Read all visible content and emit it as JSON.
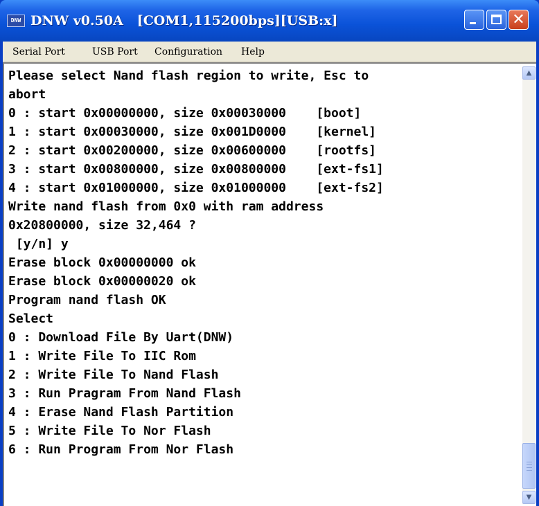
{
  "window": {
    "icon_text": "DNW",
    "title": "DNW v0.50A   [COM1,115200bps][USB:x]"
  },
  "menu": [
    "Serial Port",
    "USB Port",
    "Configuration",
    "Help"
  ],
  "console": {
    "lines": [
      "Please select Nand flash region to write, Esc to",
      "abort",
      "0 : start 0x00000000, size 0x00030000    [boot]",
      "1 : start 0x00030000, size 0x001D0000    [kernel]",
      "2 : start 0x00200000, size 0x00600000    [rootfs]",
      "3 : start 0x00800000, size 0x00800000    [ext-fs1]",
      "4 : start 0x01000000, size 0x01000000    [ext-fs2]",
      "Write nand flash from 0x0 with ram address",
      "0x20800000, size 32,464 ?",
      " [y/n] y",
      "Erase block 0x00000000 ok",
      "Erase block 0x00000020 ok",
      "Program nand flash OK",
      "Select",
      "0 : Download File By Uart(DNW)",
      "1 : Write File To IIC Rom",
      "2 : Write File To Nand Flash",
      "3 : Run Pragram From Nand Flash",
      "4 : Erase Nand Flash Partition",
      "5 : Write File To Nor Flash",
      "6 : Run Program From Nor Flash"
    ]
  },
  "scrollbar": {
    "position": 0.93
  }
}
